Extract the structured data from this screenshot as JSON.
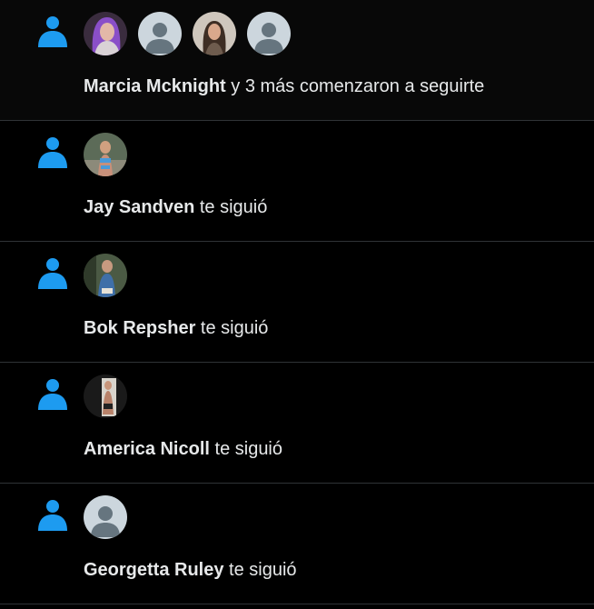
{
  "colors": {
    "accent": "#1d9bf0",
    "text": "#e7e9ea",
    "divider": "#2f3336",
    "background": "#000000",
    "highlight": "#080808",
    "default_avatar_bg": "#ccd6dd",
    "default_avatar_fg": "#66757f"
  },
  "notifications": [
    {
      "icon": "person-follow-icon",
      "highlighted": true,
      "avatars": [
        "photo-avatar",
        "default-avatar",
        "photo-avatar",
        "default-avatar"
      ],
      "name": "Marcia Mcknight",
      "text": " y 3 más comenzaron a seguirte"
    },
    {
      "icon": "person-follow-icon",
      "highlighted": false,
      "avatars": [
        "photo-avatar"
      ],
      "name": "Jay Sandven",
      "text": " te siguió"
    },
    {
      "icon": "person-follow-icon",
      "highlighted": false,
      "avatars": [
        "photo-avatar"
      ],
      "name": "Bok Repsher",
      "text": " te siguió"
    },
    {
      "icon": "person-follow-icon",
      "highlighted": false,
      "avatars": [
        "photo-avatar"
      ],
      "name": "America Nicoll",
      "text": " te siguió"
    },
    {
      "icon": "person-follow-icon",
      "highlighted": false,
      "avatars": [
        "default-avatar"
      ],
      "name": "Georgetta Ruley",
      "text": " te siguió"
    }
  ]
}
